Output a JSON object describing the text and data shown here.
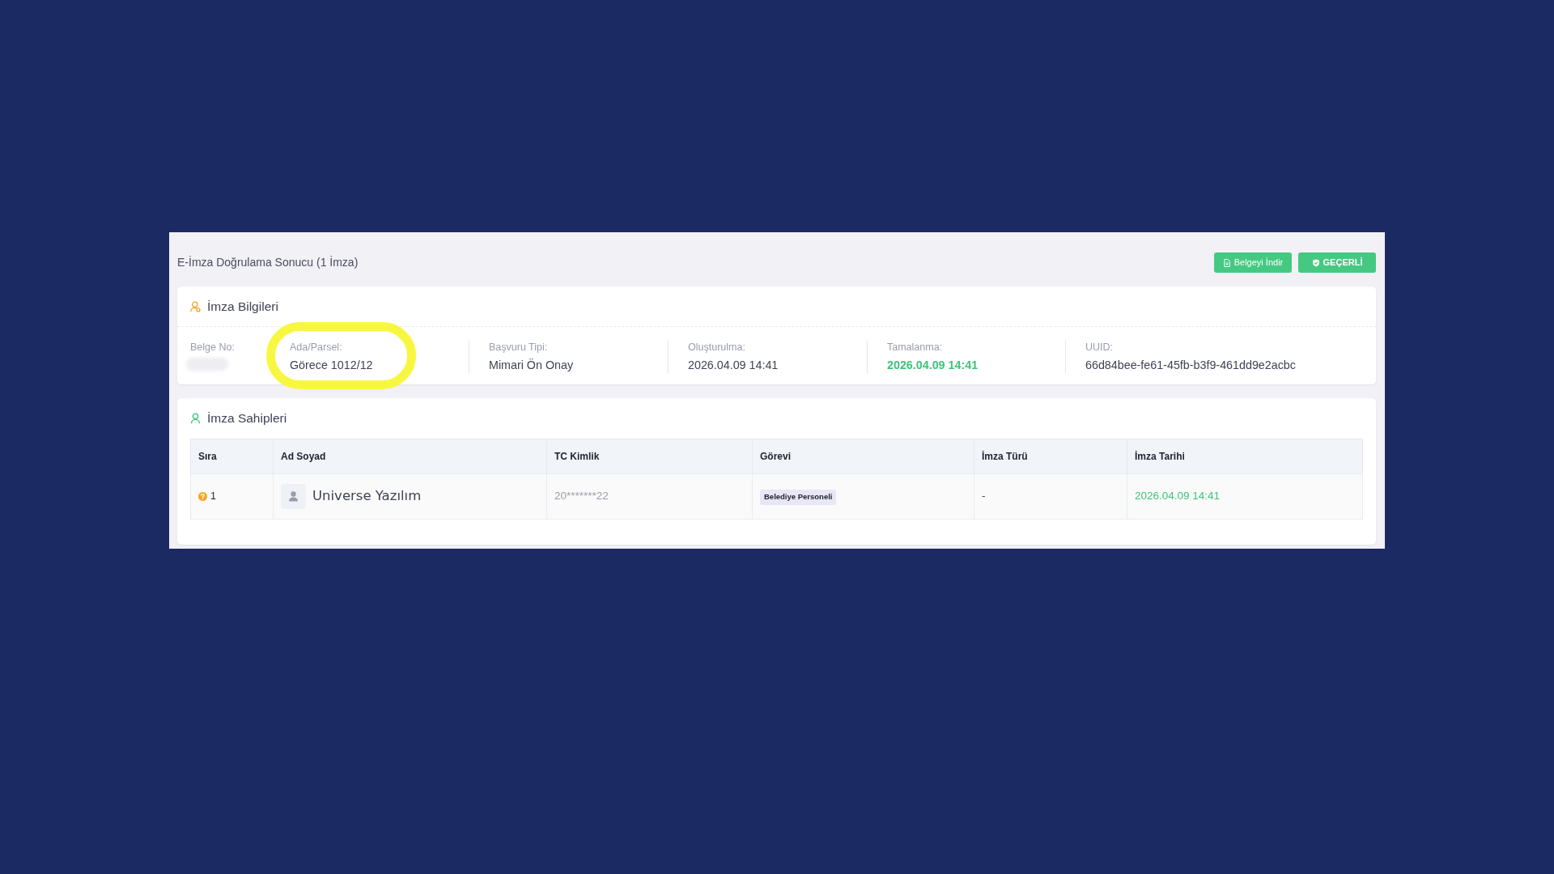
{
  "header": {
    "title": "E-İmza Doğrulama Sonucu (1 İmza)",
    "buttons": [
      {
        "label": "Belgeyi İndir",
        "kind": "download"
      },
      {
        "label": "GEÇERLİ",
        "kind": "status"
      }
    ]
  },
  "signature_info": {
    "title": "İmza Bilgileri",
    "fields": [
      {
        "label": "Belge No:",
        "kind": "redacted",
        "highlighted": false
      },
      {
        "label": "Ada/Parsel:",
        "value": "Görece 1012/12",
        "kind": "plain",
        "highlighted": true
      },
      {
        "label": "Başvuru Tipi:",
        "value": "Mimari Ön Onay",
        "kind": "plain",
        "highlighted": false
      },
      {
        "label": "Oluşturulma:",
        "value": "2026.04.09 14:41",
        "kind": "plain",
        "highlighted": false
      },
      {
        "label": "Tamalanma:",
        "value": "2026.04.09 14:41",
        "kind": "success",
        "highlighted": false
      },
      {
        "label": "UUID:",
        "value": "66d84bee-fe61-45fb-b3f9-461dd9e2acbc",
        "kind": "plain",
        "highlighted": false
      }
    ]
  },
  "signers": {
    "title": "İmza Sahipleri",
    "table": {
      "columns": [
        "Sıra",
        "Ad Soyad",
        "TC Kimlik",
        "Görevi",
        "İmza Türü",
        "İmza Tarihi"
      ],
      "rows": [
        {
          "order": "1",
          "name": "Universe Yazılım",
          "national_id": "20*******22",
          "role": "Belediye Personeli",
          "signature_type": "-",
          "signed_at": "2026.04.09 14:41"
        }
      ]
    }
  }
}
